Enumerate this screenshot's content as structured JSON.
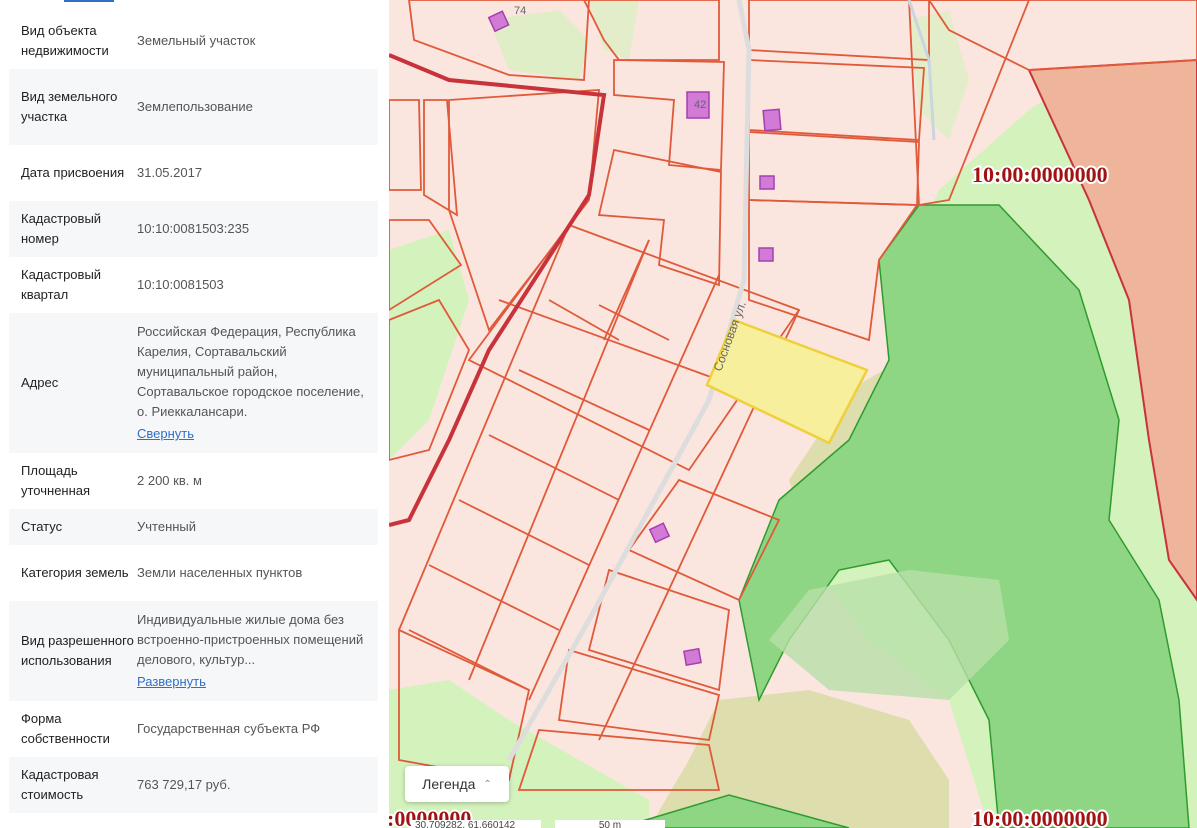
{
  "info": {
    "rows": [
      {
        "label": "Вид объекта недвижимости",
        "value": "Земельный участок"
      },
      {
        "label": "Вид земельного участка",
        "value": "Землепользование"
      },
      {
        "label": "Дата присвоения",
        "value": "31.05.2017"
      },
      {
        "label": "Кадастровый номер",
        "value": "10:10:0081503:235"
      },
      {
        "label": "Кадастровый квартал",
        "value": "10:10:0081503"
      },
      {
        "label": "Адрес",
        "value": "Российская Федерация, Республика Карелия, Сортавальский муниципальный район, Сортавальское городское поселение, о. Риеккалансари.",
        "link": "Свернуть"
      },
      {
        "label": "Площадь уточненная",
        "value": "2 200 кв. м"
      },
      {
        "label": "Статус",
        "value": "Учтенный"
      },
      {
        "label": "Категория земель",
        "value": "Земли населенных пунктов"
      },
      {
        "label": "Вид разрешенного использования",
        "value": "Индивидуальные жилые дома без встроенно-пристроенных помещений делового, культур...",
        "link": "Развернуть"
      },
      {
        "label": "Форма собственности",
        "value": "Государственная субъекта РФ"
      },
      {
        "label": "Кадастровая стоимость",
        "value": "763 729,17 руб."
      }
    ]
  },
  "map": {
    "cadastral_labels": [
      "10:00:0000000",
      "10:00:0000000",
      ":0000000"
    ],
    "street_label": "Сосновая ул.",
    "house_numbers": [
      "42",
      "74"
    ],
    "legend_label": "Легенда",
    "coords_text": "30.709282, 61.660142",
    "scale_text": "50 m",
    "colors": {
      "parcel_fill": "#fbe5df",
      "parcel_stroke": "#e05a3a",
      "boundary_stroke": "#c8323a",
      "selected_fill": "#f8ef9d",
      "selected_stroke": "#efcf3a",
      "forest_light": "#d3f2bc",
      "forest_dark": "#8fd684",
      "forest_stroke": "#2e9b2e",
      "orange_zone": "#efb59a",
      "building": "#d17ad6",
      "label_red": "#a11212"
    }
  }
}
